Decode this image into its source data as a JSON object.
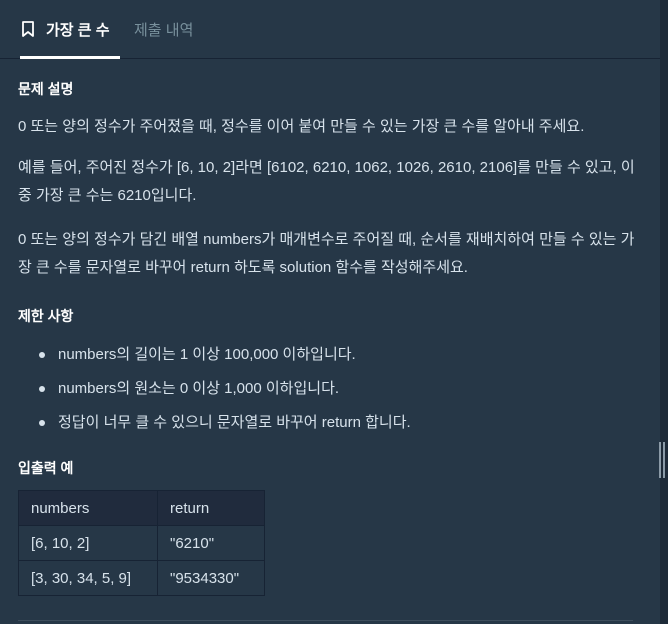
{
  "tabs": [
    {
      "label": "가장 큰 수",
      "icon": "bookmark-icon",
      "active": true
    },
    {
      "label": "제출 내역",
      "active": false
    }
  ],
  "problem": {
    "section_description": "문제 설명",
    "paragraphs": [
      "0 또는 양의 정수가 주어졌을 때, 정수를 이어 붙여 만들 수 있는 가장 큰 수를 알아내 주세요.",
      "예를 들어, 주어진 정수가 [6, 10, 2]라면 [6102, 6210, 1062, 1026, 2610, 2106]를 만들 수 있고, 이중 가장 큰 수는 6210입니다.",
      "0 또는 양의 정수가 담긴 배열 numbers가 매개변수로 주어질 때, 순서를 재배치하여 만들 수 있는 가장 큰 수를 문자열로 바꾸어 return 하도록 solution 함수를 작성해주세요."
    ],
    "section_constraints": "제한 사항",
    "constraints": [
      "numbers의 길이는 1 이상 100,000 이하입니다.",
      "numbers의 원소는 0 이상 1,000 이하입니다.",
      "정답이 너무 클 수 있으니 문자열로 바꾸어 return 합니다."
    ],
    "section_examples": "입출력 예",
    "examples_table": {
      "headers": [
        "numbers",
        "return"
      ],
      "rows": [
        [
          "[6, 10, 2]",
          "\"6210\""
        ],
        [
          "[3, 30, 34, 5, 9]",
          "\"9534330\""
        ]
      ]
    }
  },
  "colors": {
    "background": "#263747",
    "table_header": "#202b3d",
    "text": "#d7e2eb",
    "heading": "#ffffff",
    "inactive_tab": "#78909c"
  }
}
